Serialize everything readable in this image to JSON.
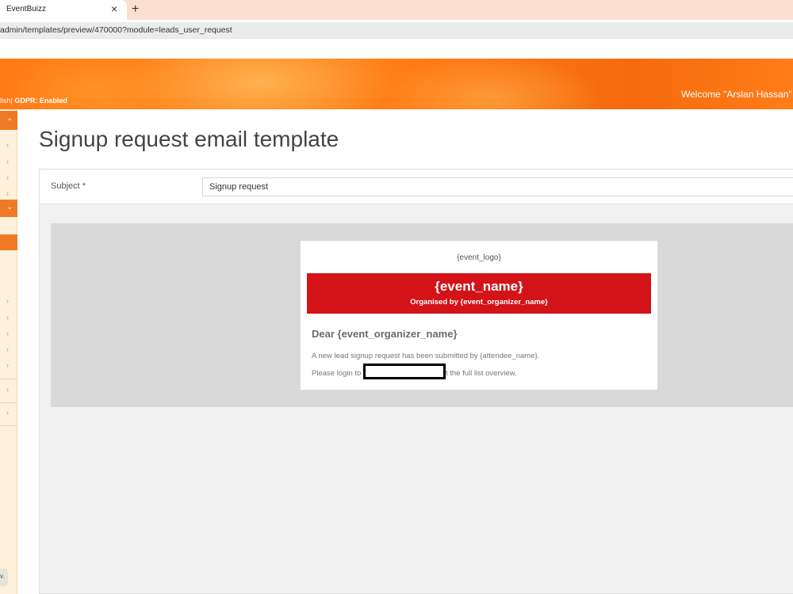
{
  "browser": {
    "tab_title": "EventBuizz",
    "tab_close": "×",
    "new_tab": "+",
    "url": "admin/templates/preview/470000?module=leads_user_request"
  },
  "header": {
    "lang_prefix": "lish|",
    "gdpr": "GDPR: Enabled",
    "welcome": "Welcome \"Arslan Hassan\""
  },
  "sidebar": {
    "chevron": "›",
    "active_chevron": "⌄",
    "bottom_icon": "v."
  },
  "page": {
    "title": "Signup request email template"
  },
  "form": {
    "subject_label": "Subject *",
    "subject_value": "Signup request"
  },
  "email": {
    "logo": "{event_logo}",
    "event_name": "{event_name}",
    "organised_by": "Organised by {event_organizer_name}",
    "dear": "Dear {event_organizer_name}",
    "line1": "A new lead signup request has been submitted by {attendee_name}.",
    "line2_before": "Please login to ",
    "line2_after": "t the full list overview."
  },
  "colors": {
    "accent_orange": "#f07a24",
    "email_header_red": "#d31317"
  }
}
